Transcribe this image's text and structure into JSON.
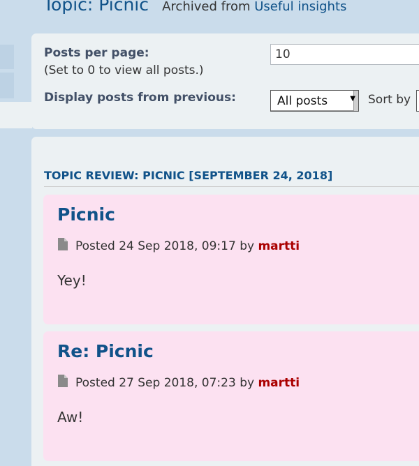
{
  "header": {
    "topic_title": "Topic: Picnic",
    "archived_prefix": "Archived from",
    "archived_link": "Useful insights"
  },
  "options": {
    "posts_per_page_label": "Posts per page:",
    "posts_per_page_note": "(Set to 0 to view all posts.)",
    "posts_per_page_value": "10",
    "display_from_label": "Display posts from previous:",
    "display_from_selected": "All posts",
    "sort_by_label": "Sort by"
  },
  "review": {
    "heading": "TOPIC REVIEW: PICNIC [SEPTEMBER 24, 2018]",
    "posts": [
      {
        "title": "Picnic",
        "posted_prefix": "Posted",
        "date": "24 Sep 2018, 09:17",
        "by": "by",
        "author": "martti",
        "body": "Yey!"
      },
      {
        "title": "Re: Picnic",
        "posted_prefix": "Posted",
        "date": "27 Sep 2018, 07:23",
        "by": "by",
        "author": "martti",
        "body": "Aw!"
      }
    ]
  },
  "colors": {
    "page_background": "#cadceb",
    "panel_background": "#ecf1f3",
    "post_background": "#fce1f1",
    "link_blue": "#105289",
    "author_red": "#aa0000"
  },
  "icons": {
    "post_icon": "document-icon",
    "select_arrow": "chevron-down-icon"
  }
}
